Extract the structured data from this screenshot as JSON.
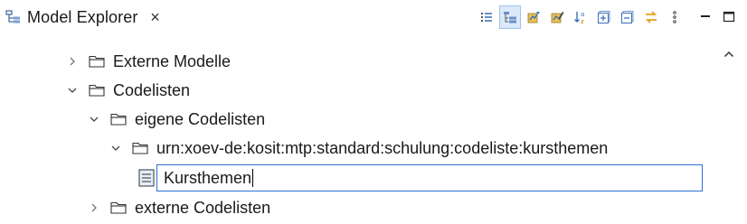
{
  "tab": {
    "title": "Model Explorer",
    "close_glyph": "×",
    "icon": "model-explorer-icon"
  },
  "toolbar": {
    "buttons": [
      {
        "name": "flat-layout-icon",
        "active": false
      },
      {
        "name": "hierarchical-layout-icon",
        "active": true
      },
      {
        "name": "filter-icon",
        "active": false
      },
      {
        "name": "filter-edit-icon",
        "active": false
      },
      {
        "name": "sort-alphabetically-icon",
        "active": false
      },
      {
        "name": "expand-all-icon",
        "active": false
      },
      {
        "name": "collapse-all-icon",
        "active": false
      },
      {
        "name": "link-with-editor-icon",
        "active": false
      },
      {
        "name": "view-menu-icon",
        "active": false
      },
      {
        "name": "minimize-icon",
        "active": false
      },
      {
        "name": "maximize-icon",
        "active": false
      }
    ]
  },
  "tree": {
    "items": [
      {
        "label": "Externe Modelle",
        "expanded": false
      },
      {
        "label": "Codelisten",
        "expanded": true
      },
      {
        "label": "eigene Codelisten",
        "expanded": true
      },
      {
        "label": "urn:xoev-de:kosit:mtp:standard:schulung:codeliste:kursthemen",
        "expanded": true
      },
      {
        "label": "externe Codelisten",
        "expanded": false
      }
    ],
    "editing": {
      "value": "Kursthemen",
      "icon": "codelist-icon"
    }
  },
  "colors": {
    "accent": "#2f6fd6",
    "active_button_bg": "#dbe9f8",
    "text": "#1a1a1a"
  }
}
